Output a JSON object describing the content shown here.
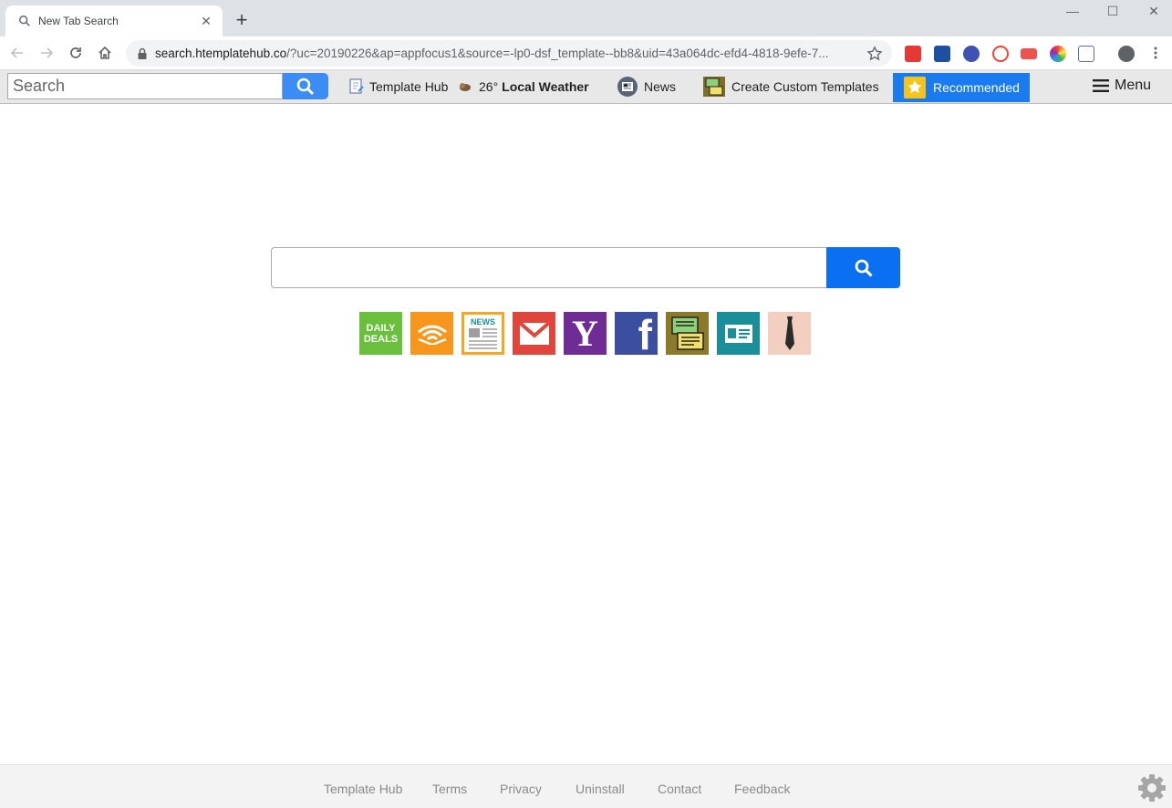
{
  "browser": {
    "tab_title": "New Tab Search",
    "new_tab_symbol": "+",
    "close_symbol": "✕",
    "window_minimize": "—",
    "window_maximize": "☐",
    "window_close": "✕",
    "url_host": "search.htemplatehub.co",
    "url_rest": "/?uc=20190226&ap=appfocus1&source=-lp0-dsf_template--bb8&uid=43a064dc-efd4-4818-9efe-7..."
  },
  "toolbar": {
    "search_placeholder": "Search",
    "template_hub_label": "Template Hub",
    "weather_temp": "26°",
    "weather_label": "Local Weather",
    "news_label": "News",
    "create_templates_label": "Create Custom Templates",
    "recommended_label": "Recommended",
    "menu_label": "Menu"
  },
  "main": {
    "search_placeholder": "",
    "tiles": [
      {
        "name": "daily-deals",
        "line1": "DAILY",
        "line2": "DEALS",
        "color": "#6abf3c"
      },
      {
        "name": "audible",
        "color": "#f7961d"
      },
      {
        "name": "news",
        "label": "NEWS",
        "color": "#f5a623"
      },
      {
        "name": "gmail",
        "color": "#e0463b"
      },
      {
        "name": "yahoo",
        "label": "Y",
        "color": "#6e2c94"
      },
      {
        "name": "facebook",
        "label": "f",
        "color": "#3b4fa0"
      },
      {
        "name": "templates",
        "color": "#8a7a2a"
      },
      {
        "name": "contacts",
        "color": "#1a8e99"
      },
      {
        "name": "tie",
        "color": "#f2cfbe"
      }
    ]
  },
  "footer": {
    "links": [
      "Template Hub",
      "Terms",
      "Privacy",
      "Uninstall",
      "Contact",
      "Feedback"
    ]
  },
  "colors": {
    "toolbar_blue": "#3c8cf5",
    "main_blue": "#0b6ff2",
    "recommended_blue": "#1a7bf0"
  }
}
